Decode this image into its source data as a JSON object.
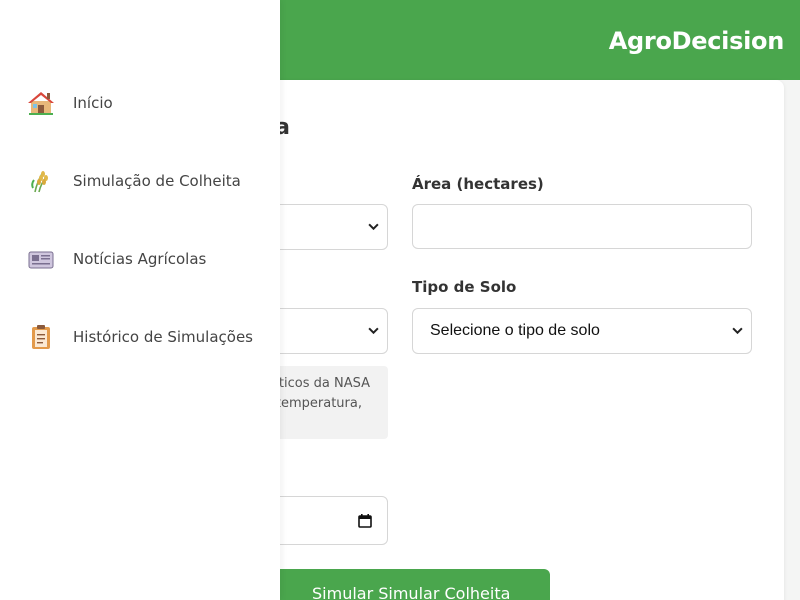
{
  "app": {
    "brand": "AgroDecision"
  },
  "sidebar": {
    "items": [
      {
        "label": "Início",
        "icon": "house-icon"
      },
      {
        "label": "Simulação de Colheita",
        "icon": "wheat-icon"
      },
      {
        "label": "Notícias Agrícolas",
        "icon": "newspaper-icon"
      },
      {
        "label": "Histórico de Simulações",
        "icon": "clipboard-icon"
      }
    ]
  },
  "form": {
    "title_fragment": "a",
    "area_label": "Área (hectares)",
    "area_value": "",
    "soil_label": "Tipo de Solo",
    "soil_selected": "Selecione o tipo de solo",
    "info_line1": "ticos da NASA",
    "info_line2": "temperatura,",
    "submit_label": "Simular Simular Colheita"
  },
  "colors": {
    "primary": "#4aa64d",
    "sidebar_bg": "#ffffff",
    "info_bg": "#f2f2f2"
  }
}
